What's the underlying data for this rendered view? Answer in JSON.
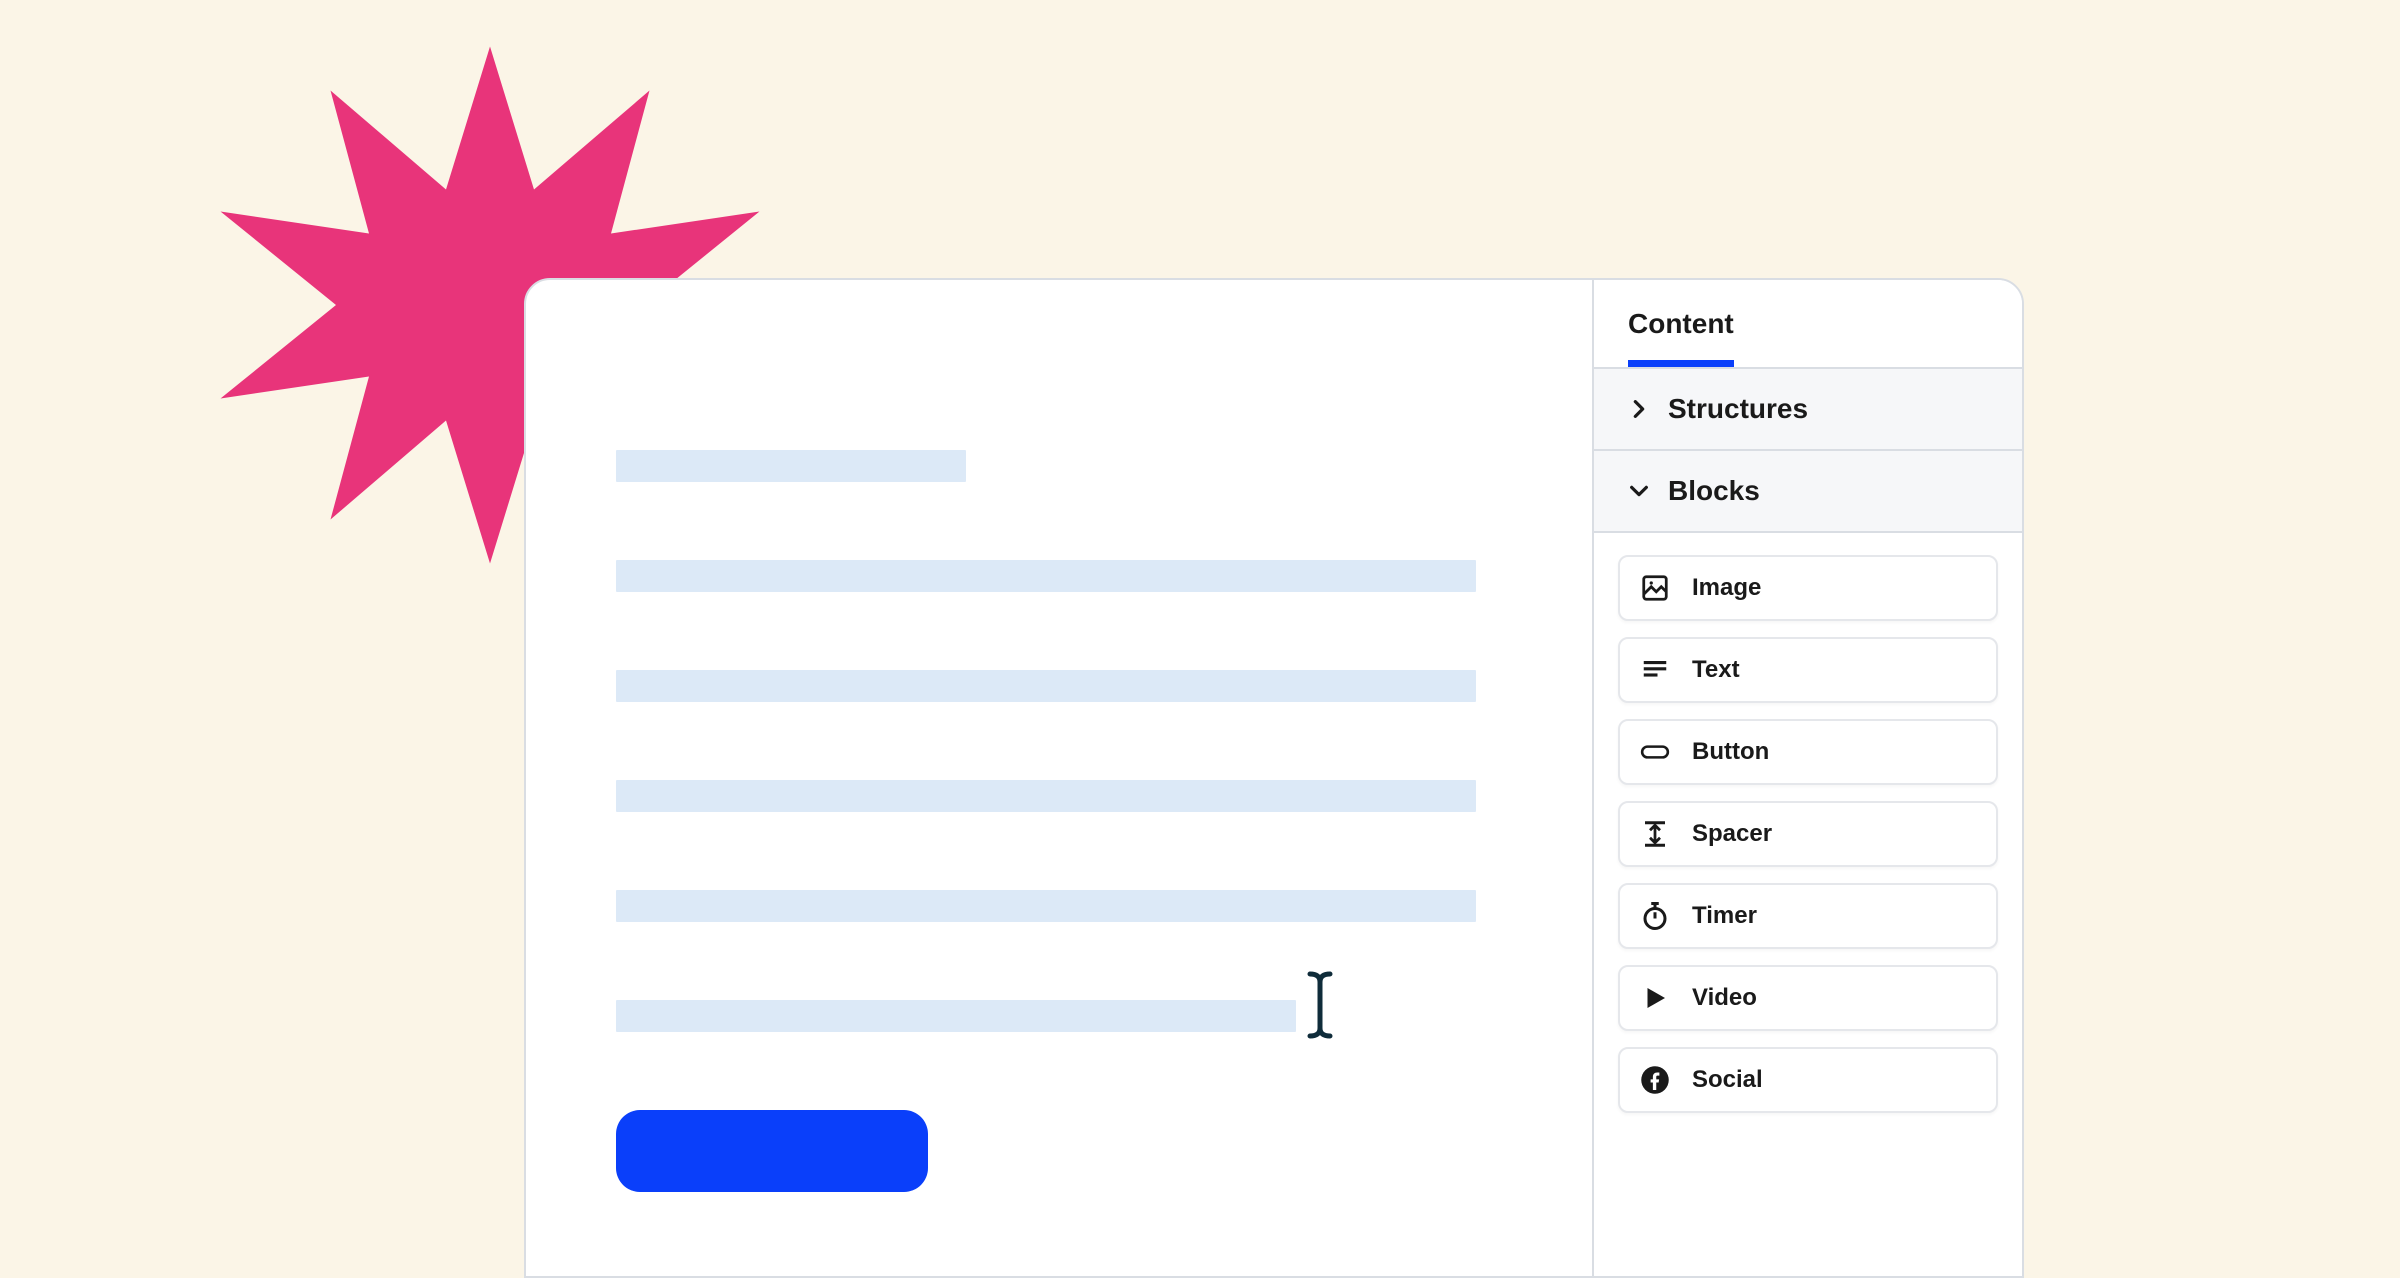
{
  "sidebar": {
    "tab": "Content",
    "sections": {
      "structures": "Structures",
      "blocks": "Blocks"
    },
    "block_items": [
      {
        "icon": "image-icon",
        "label": "Image"
      },
      {
        "icon": "text-icon",
        "label": "Text"
      },
      {
        "icon": "button-icon",
        "label": "Button"
      },
      {
        "icon": "spacer-icon",
        "label": "Spacer"
      },
      {
        "icon": "timer-icon",
        "label": "Timer"
      },
      {
        "icon": "video-icon",
        "label": "Video"
      },
      {
        "icon": "social-icon",
        "label": "Social"
      }
    ]
  },
  "colors": {
    "accent": "#0A3FFA",
    "starburst": "#E8347A",
    "placeholder": "#DCE9F7",
    "background": "#FBF5E7"
  }
}
